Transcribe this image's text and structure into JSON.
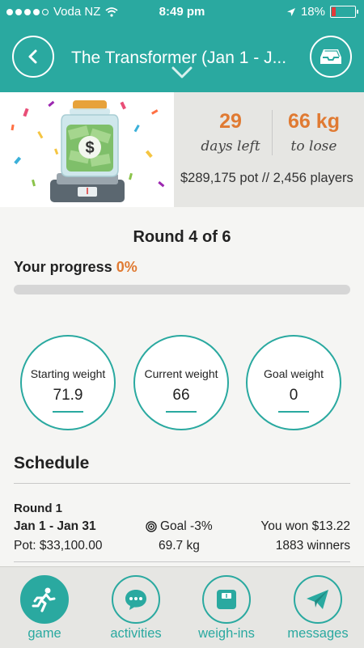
{
  "status_bar": {
    "carrier": "Voda NZ",
    "time": "8:49 pm",
    "battery": "18%",
    "battery_level": 0.18
  },
  "header": {
    "title": "The Transformer (Jan 1 - J...",
    "back_icon": "chevron-left-icon",
    "inbox_icon": "inbox-tray-icon"
  },
  "hero": {
    "days_left_value": "29",
    "days_left_label": "days left",
    "to_lose_value": "66 kg",
    "to_lose_label": "to lose",
    "pot_players": "$289,175 pot // 2,456 players"
  },
  "round": {
    "title": "Round 4 of 6",
    "progress_label": "Your progress",
    "progress_pct": "0%",
    "progress_value": 0
  },
  "weights": [
    {
      "label": "Starting weight",
      "value": "71.9"
    },
    {
      "label": "Current weight",
      "value": "66"
    },
    {
      "label": "Goal weight",
      "value": "0"
    }
  ],
  "schedule": {
    "title": "Schedule",
    "rounds": [
      {
        "name": "Round 1",
        "dates": "Jan 1 - Jan 31",
        "pot": "Pot: $33,100.00",
        "goal": "Goal -3%",
        "goal_kg": "69.7 kg",
        "won": "You won $13.22",
        "winners": "1883 winners"
      }
    ]
  },
  "tabs": [
    {
      "label": "game",
      "icon": "runner-icon",
      "active": true
    },
    {
      "label": "activities",
      "icon": "chat-bubble-icon",
      "active": false
    },
    {
      "label": "weigh-ins",
      "icon": "scale-icon",
      "active": false
    },
    {
      "label": "messages",
      "icon": "paper-plane-icon",
      "active": false
    }
  ],
  "colors": {
    "accent": "#2aa9a0",
    "highlight": "#e07a32"
  }
}
